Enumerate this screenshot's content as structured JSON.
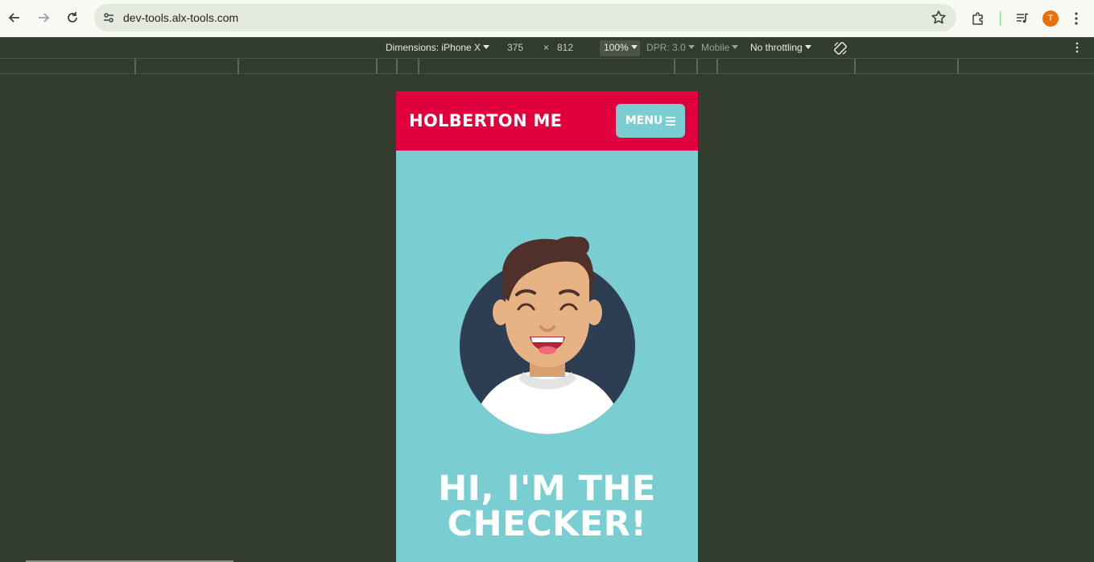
{
  "browser": {
    "url": "dev-tools.alx-tools.com",
    "profile_initial": "T",
    "icons": [
      "back-arrow-icon",
      "forward-arrow-icon",
      "reload-icon",
      "site-info-icon",
      "bookmark-star-icon",
      "extensions-icon",
      "media-controls-icon",
      "more-menu-icon"
    ]
  },
  "devtools": {
    "dimensions_label": "Dimensions: iPhone X",
    "width_value": "375",
    "times": "×",
    "height_value": "812",
    "zoom": "100%",
    "dpr": "DPR: 3.0",
    "mode": "Mobile",
    "throttling": "No throttling"
  },
  "page": {
    "brand": "HOLBERTON ME",
    "menu_label": "MENU",
    "hero_line1": "HI, I'M THE",
    "hero_line2": "CHECKER!",
    "colors": {
      "header": "#e1003e",
      "background": "#7acdd1",
      "avatar_circle": "#2e3e52",
      "hair": "#50302b",
      "skin": "#e8b384"
    }
  }
}
